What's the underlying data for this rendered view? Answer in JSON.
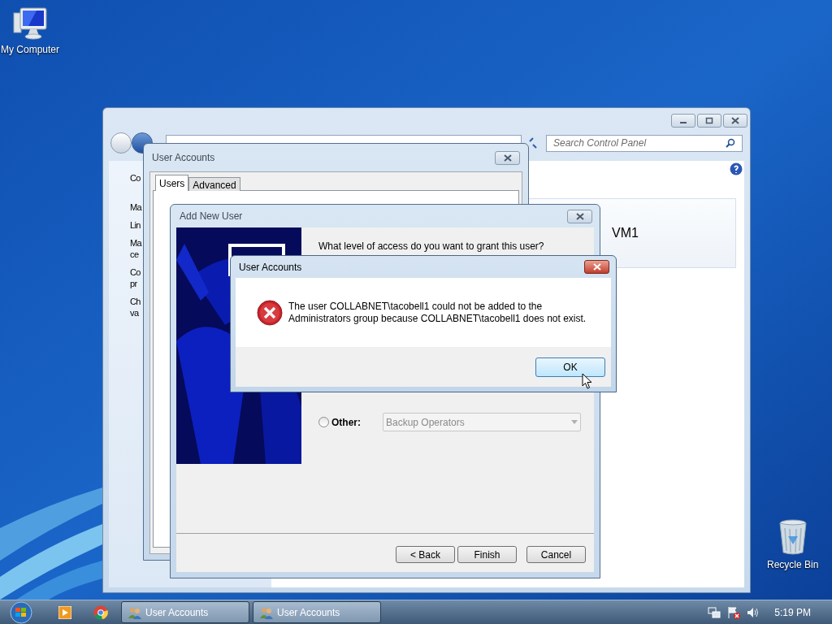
{
  "desktop_icons": [
    {
      "label": "My Computer",
      "kind": "computer"
    },
    {
      "label": "Recycle Bin",
      "kind": "bin"
    }
  ],
  "control_panel": {
    "search": {
      "placeholder": "Search Control Panel"
    },
    "sidebar_fragments": [
      {
        "lines": [
          "Co"
        ]
      },
      {
        "lines": [
          "Ma"
        ]
      },
      {
        "lines": [
          "Lin"
        ]
      },
      {
        "lines": [
          "Ma",
          "ce"
        ]
      },
      {
        "lines": [
          "Co",
          "pr"
        ]
      },
      {
        "lines": [
          "Ch",
          "va"
        ]
      }
    ],
    "computer_name": "VM1"
  },
  "user_accounts_dialog": {
    "title": "User Accounts",
    "tabs": [
      {
        "label": "Users",
        "selected": true
      },
      {
        "label": "Advanced",
        "selected": false
      }
    ]
  },
  "add_user_wizard": {
    "title": "Add New User",
    "question": "What level of access do you want to grant this user?",
    "other_option": {
      "label": "Other:",
      "selected": false,
      "value": "Backup Operators",
      "disabled": true
    },
    "buttons": [
      "< Back",
      "Finish",
      "Cancel"
    ]
  },
  "error_dialog": {
    "title": "User Accounts",
    "message": "The user COLLABNET\\tacobell1 could not be added to the Administrators group because COLLABNET\\tacobell1 does not exist.",
    "buttons": [
      {
        "label": "OK",
        "focused": true
      }
    ]
  },
  "taskbar": {
    "pinned": [
      {
        "kind": "media"
      },
      {
        "kind": "browser"
      }
    ],
    "tasks": [
      {
        "label": "User Accounts"
      },
      {
        "label": "User Accounts"
      }
    ],
    "clock": "5:19 PM"
  }
}
